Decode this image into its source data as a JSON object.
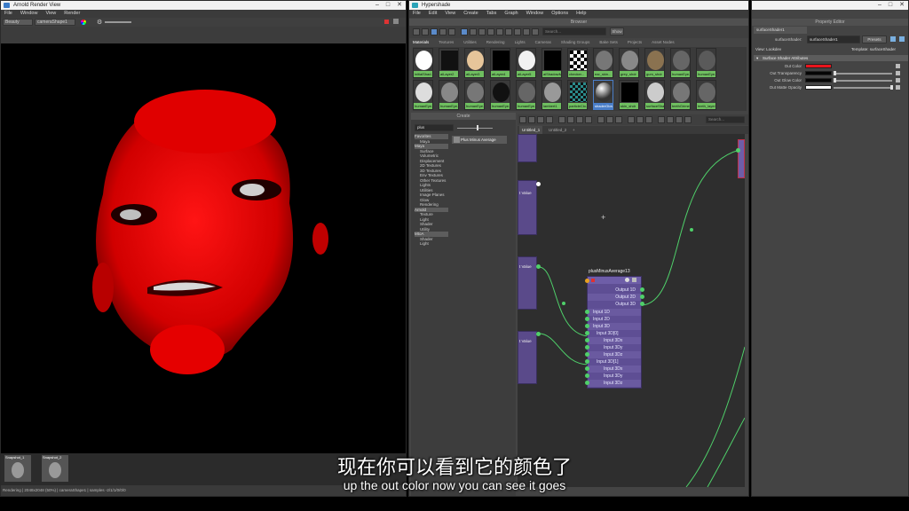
{
  "render_view": {
    "title": "Arnold Render View",
    "menu": [
      "File",
      "Window",
      "View",
      "Render"
    ],
    "aov": "Beauty",
    "camera": "cameraShape1",
    "snapshots": [
      "Snapshot_1",
      "Snapshot_2"
    ],
    "status": "Rendering | 2048x2048 (50%) | cameraShape1 | samples -2/1/1/0/0/0"
  },
  "hypershade": {
    "title": "Hypershade",
    "menu": [
      "File",
      "Edit",
      "View",
      "Create",
      "Tabs",
      "Graph",
      "Window",
      "Options",
      "Help"
    ],
    "browser": {
      "header": "Browser",
      "search_placeholder": "Search...",
      "show_label": "Show",
      "tabs": [
        "Materials",
        "Textures",
        "Utilities",
        "Rendering",
        "Lights",
        "Cameras",
        "Shading Groups",
        "Bake Sets",
        "Projects",
        "Asset Nodes"
      ],
      "swatches_row1": [
        "initialShad...",
        "aiLayer2",
        "aiLayer3",
        "aiLayer4",
        "aiLayer5",
        "aiShadowMat...",
        "checker...",
        "ear_skin...",
        "grey_shdr",
        "gum_shdr",
        "humanEye...",
        "humanEye..."
      ],
      "swatches_row2": [
        "humanEye...",
        "humanEye...",
        "humanEye...",
        "humanEye...",
        "humanEye...",
        "lambert1",
        "particleClo...",
        "shaderGlow1",
        "skin_shdr",
        "surfaceSha...",
        "teethGrime...",
        "teeth_layer"
      ]
    },
    "create": {
      "header": "Create",
      "search_value": "plus",
      "result": "Plus Minus Average",
      "tree": [
        {
          "label": "Favorites",
          "cat": true
        },
        {
          "label": "Maya",
          "cat": false
        },
        {
          "label": "Maya",
          "cat": true
        },
        {
          "label": "Surface",
          "cat": false
        },
        {
          "label": "Volumetric",
          "cat": false
        },
        {
          "label": "Displacement",
          "cat": false
        },
        {
          "label": "2D Textures",
          "cat": false
        },
        {
          "label": "3D Textures",
          "cat": false
        },
        {
          "label": "Env Textures",
          "cat": false
        },
        {
          "label": "Other Textures",
          "cat": false
        },
        {
          "label": "Lights",
          "cat": false
        },
        {
          "label": "Utilities",
          "cat": false
        },
        {
          "label": "Image Planes",
          "cat": false
        },
        {
          "label": "Glow",
          "cat": false
        },
        {
          "label": "Rendering",
          "cat": false
        },
        {
          "label": "Arnold",
          "cat": true
        },
        {
          "label": "Texture",
          "cat": false
        },
        {
          "label": "Light",
          "cat": false
        },
        {
          "label": "Shader",
          "cat": false
        },
        {
          "label": "Utility",
          "cat": false
        },
        {
          "label": "MtoA",
          "cat": true
        },
        {
          "label": "Shader",
          "cat": false
        },
        {
          "label": "Light",
          "cat": false
        }
      ]
    },
    "graph": {
      "tabs": [
        "Untitled_1",
        "Untitled_2"
      ],
      "search_placeholder": "Search...",
      "node_stub_labels": [
        "t Value",
        "t Value",
        "t Value"
      ],
      "pma_node": {
        "title": "plusMinusAverage13",
        "outputs": [
          "Output 1D",
          "Output 2D",
          "Output 3D"
        ],
        "inputs": [
          "Input 1D",
          "Input 2D",
          "Input 3D",
          "Input 3D[0]",
          "Input 3Dx",
          "Input 3Dy",
          "Input 3Dz",
          "Input 3D[1]",
          "Input 3Dx",
          "Input 3Dy",
          "Input 3Dz"
        ]
      }
    }
  },
  "property_editor": {
    "header": "Property Editor",
    "node_name": "surfaceShader1",
    "type_label": "surfaceShader:",
    "type_value": "surfaceShader1",
    "presets_label": "Presets",
    "view_label": "View: Lookdev",
    "template_label": "Template: surfaceShader",
    "section": "Surface Shader Attributes",
    "attributes": [
      {
        "name": "Out Color",
        "color": "#e8141c"
      },
      {
        "name": "Out Transparency",
        "color": "#050505"
      },
      {
        "name": "Out Glow Color",
        "color": "#050505"
      },
      {
        "name": "Out Matte Opacity",
        "color": "#ffffff"
      }
    ]
  },
  "subtitles": {
    "cn": "现在你可以看到它的颜色了",
    "en": "up the out color now you can see it goes"
  }
}
